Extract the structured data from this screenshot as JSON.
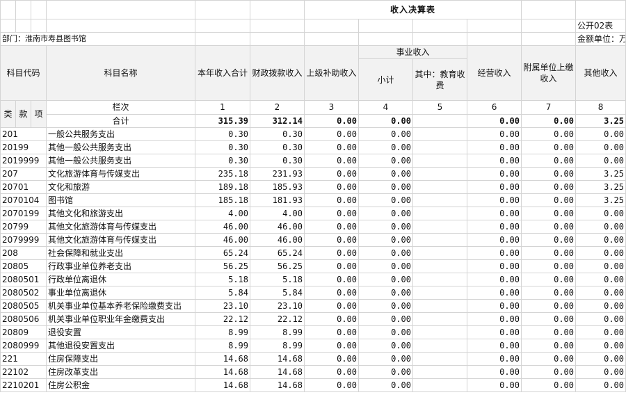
{
  "title": "收入决算表",
  "form_no": "公开02表",
  "department": "部门：淮南市寿县图书馆",
  "unit": "金额单位：万元",
  "headers": {
    "code": "科目代码",
    "name": "科目名称",
    "total": "本年收入合计",
    "fiscal": "财政拨款收入",
    "upper": "上级补助收入",
    "business": "事业收入",
    "subtotal": "小计",
    "edu": "其中：教育收费",
    "operating": "经营收入",
    "affiliated": "附属单位上缴收入",
    "other": "其他收入",
    "lei": "类",
    "kuan": "款",
    "xiang": "项",
    "column_row": "栏次",
    "sum_label": "合计"
  },
  "col_numbers": [
    "1",
    "2",
    "3",
    "4",
    "5",
    "6",
    "7",
    "8"
  ],
  "totals": [
    "315.39",
    "312.14",
    "0.00",
    "0.00",
    "",
    "0.00",
    "0.00",
    "3.25"
  ],
  "rows": [
    {
      "code": "201",
      "name": "一般公共服务支出",
      "v": [
        "0.30",
        "0.30",
        "0.00",
        "0.00",
        "",
        "0.00",
        "0.00",
        "0.00"
      ]
    },
    {
      "code": "20199",
      "name": "其他一般公共服务支出",
      "v": [
        "0.30",
        "0.30",
        "0.00",
        "0.00",
        "",
        "0.00",
        "0.00",
        "0.00"
      ]
    },
    {
      "code": "2019999",
      "name": "其他一般公共服务支出",
      "v": [
        "0.30",
        "0.30",
        "0.00",
        "0.00",
        "",
        "0.00",
        "0.00",
        "0.00"
      ]
    },
    {
      "code": "207",
      "name": "文化旅游体育与传媒支出",
      "v": [
        "235.18",
        "231.93",
        "0.00",
        "0.00",
        "",
        "0.00",
        "0.00",
        "3.25"
      ]
    },
    {
      "code": "20701",
      "name": "文化和旅游",
      "v": [
        "189.18",
        "185.93",
        "0.00",
        "0.00",
        "",
        "0.00",
        "0.00",
        "3.25"
      ]
    },
    {
      "code": "2070104",
      "name": "图书馆",
      "v": [
        "185.18",
        "181.93",
        "0.00",
        "0.00",
        "",
        "0.00",
        "0.00",
        "3.25"
      ]
    },
    {
      "code": "2070199",
      "name": "其他文化和旅游支出",
      "v": [
        "4.00",
        "4.00",
        "0.00",
        "0.00",
        "",
        "0.00",
        "0.00",
        "0.00"
      ]
    },
    {
      "code": "20799",
      "name": "其他文化旅游体育与传媒支出",
      "v": [
        "46.00",
        "46.00",
        "0.00",
        "0.00",
        "",
        "0.00",
        "0.00",
        "0.00"
      ]
    },
    {
      "code": "2079999",
      "name": "其他文化旅游体育与传媒支出",
      "v": [
        "46.00",
        "46.00",
        "0.00",
        "0.00",
        "",
        "0.00",
        "0.00",
        "0.00"
      ]
    },
    {
      "code": "208",
      "name": "社会保障和就业支出",
      "v": [
        "65.24",
        "65.24",
        "0.00",
        "0.00",
        "",
        "0.00",
        "0.00",
        "0.00"
      ]
    },
    {
      "code": "20805",
      "name": "行政事业单位养老支出",
      "v": [
        "56.25",
        "56.25",
        "0.00",
        "0.00",
        "",
        "0.00",
        "0.00",
        "0.00"
      ]
    },
    {
      "code": "2080501",
      "name": "行政单位离退休",
      "v": [
        "5.18",
        "5.18",
        "0.00",
        "0.00",
        "",
        "0.00",
        "0.00",
        "0.00"
      ]
    },
    {
      "code": "2080502",
      "name": "事业单位离退休",
      "v": [
        "5.84",
        "5.84",
        "0.00",
        "0.00",
        "",
        "0.00",
        "0.00",
        "0.00"
      ]
    },
    {
      "code": "2080505",
      "name": "机关事业单位基本养老保险缴费支出",
      "v": [
        "23.10",
        "23.10",
        "0.00",
        "0.00",
        "",
        "0.00",
        "0.00",
        "0.00"
      ]
    },
    {
      "code": "2080506",
      "name": "机关事业单位职业年金缴费支出",
      "v": [
        "22.12",
        "22.12",
        "0.00",
        "0.00",
        "",
        "0.00",
        "0.00",
        "0.00"
      ]
    },
    {
      "code": "20809",
      "name": "退役安置",
      "v": [
        "8.99",
        "8.99",
        "0.00",
        "0.00",
        "",
        "0.00",
        "0.00",
        "0.00"
      ]
    },
    {
      "code": "2080999",
      "name": "其他退役安置支出",
      "v": [
        "8.99",
        "8.99",
        "0.00",
        "0.00",
        "",
        "0.00",
        "0.00",
        "0.00"
      ]
    },
    {
      "code": "221",
      "name": "住房保障支出",
      "v": [
        "14.68",
        "14.68",
        "0.00",
        "0.00",
        "",
        "0.00",
        "0.00",
        "0.00"
      ]
    },
    {
      "code": "22102",
      "name": "住房改革支出",
      "v": [
        "14.68",
        "14.68",
        "0.00",
        "0.00",
        "",
        "0.00",
        "0.00",
        "0.00"
      ]
    },
    {
      "code": "2210201",
      "name": "住房公积金",
      "v": [
        "14.68",
        "14.68",
        "0.00",
        "0.00",
        "",
        "0.00",
        "0.00",
        "0.00"
      ]
    }
  ]
}
